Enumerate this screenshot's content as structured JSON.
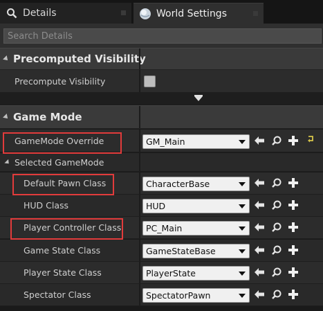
{
  "tabs": [
    {
      "label": "Details",
      "icon": "magnifier-icon"
    },
    {
      "label": "World Settings",
      "icon": "globe-icon"
    }
  ],
  "search": {
    "placeholder": "Search Details"
  },
  "categories": {
    "precomputed": {
      "label": "Precomputed Visibility"
    },
    "gamemode": {
      "label": "Game Mode"
    }
  },
  "precompute_row": {
    "label": "Precompute Visibility",
    "checked": false
  },
  "gamemode_override": {
    "label": "GameMode Override",
    "value": "GM_Main"
  },
  "selected_gamemode": {
    "label": "Selected GameMode"
  },
  "properties": [
    {
      "label": "Default Pawn Class",
      "value": "CharacterBase"
    },
    {
      "label": "HUD Class",
      "value": "HUD"
    },
    {
      "label": "Player Controller Class",
      "value": "PC_Main"
    },
    {
      "label": "Game State Class",
      "value": "GameStateBase"
    },
    {
      "label": "Player State Class",
      "value": "PlayerState"
    },
    {
      "label": "Spectator Class",
      "value": "SpectatorPawn"
    }
  ],
  "colors": {
    "highlight": "#e23b3b",
    "panel": "#2c2c2c",
    "header": "#3a3a3a",
    "reset_arrow": "#d8c64a"
  },
  "icons": {
    "use": "arrow-left-icon",
    "browse": "magnifier-icon",
    "add": "plus-icon",
    "reset": "reset-to-default-icon"
  }
}
